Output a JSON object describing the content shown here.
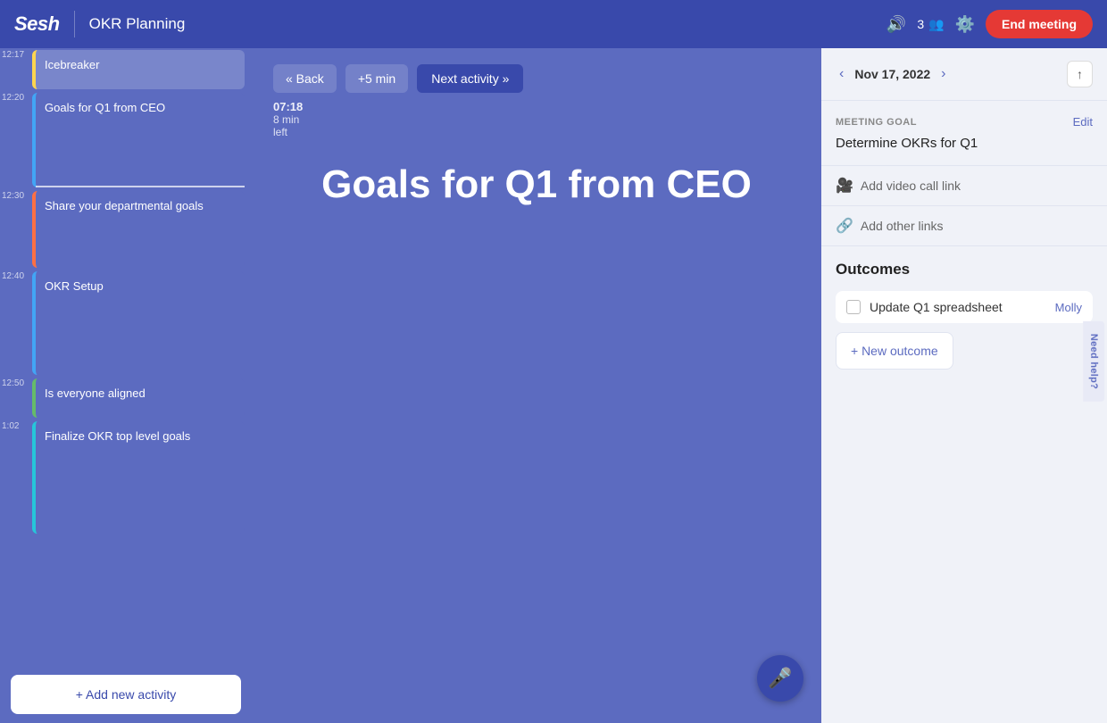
{
  "header": {
    "logo": "Sesh",
    "meeting_title": "OKR Planning",
    "participants_count": "3",
    "end_meeting_label": "End meeting"
  },
  "sidebar": {
    "add_activity_label": "+ Add new activity",
    "agenda_items": [
      {
        "id": "icebreaker",
        "time": "12:17",
        "label": "Icebreaker",
        "style": "active",
        "border": "yellow"
      },
      {
        "id": "goals-ceo",
        "time": "12:20",
        "label": "Goals for Q1 from CEO",
        "style": "blue",
        "border": "blue"
      },
      {
        "id": "dept-goals",
        "time": "12:30",
        "label": "Share your departmental goals",
        "style": "orange",
        "border": "orange"
      },
      {
        "id": "okr-setup",
        "time": "12:40",
        "label": "OKR Setup",
        "style": "blue",
        "border": "blue"
      },
      {
        "id": "everyone-aligned",
        "time": "12:50",
        "label": "Is everyone aligned",
        "style": "green",
        "border": "green"
      },
      {
        "id": "finalize",
        "time": "1:02",
        "label": "Finalize OKR top level goals",
        "style": "teal",
        "border": "teal"
      }
    ]
  },
  "activity_nav": {
    "back_label": "« Back",
    "add_time_label": "+5 min",
    "next_label": "Next activity »"
  },
  "content": {
    "current_activity_title": "Goals for Q1 from CEO",
    "timer": "07:18",
    "min_label": "8 min",
    "left_label": "left"
  },
  "right_panel": {
    "date": "Nov 17, 2022",
    "meeting_goal_label": "MEETING GOAL",
    "edit_label": "Edit",
    "meeting_goal_text": "Determine OKRs for Q1",
    "add_video_label": "Add video call link",
    "add_links_label": "Add other links",
    "outcomes_title": "Outcomes",
    "outcomes": [
      {
        "id": "o1",
        "text": "Update Q1 spreadsheet",
        "assignee": "Molly",
        "done": false
      }
    ],
    "new_outcome_label": "+ New outcome",
    "need_help_label": "Need help?"
  }
}
